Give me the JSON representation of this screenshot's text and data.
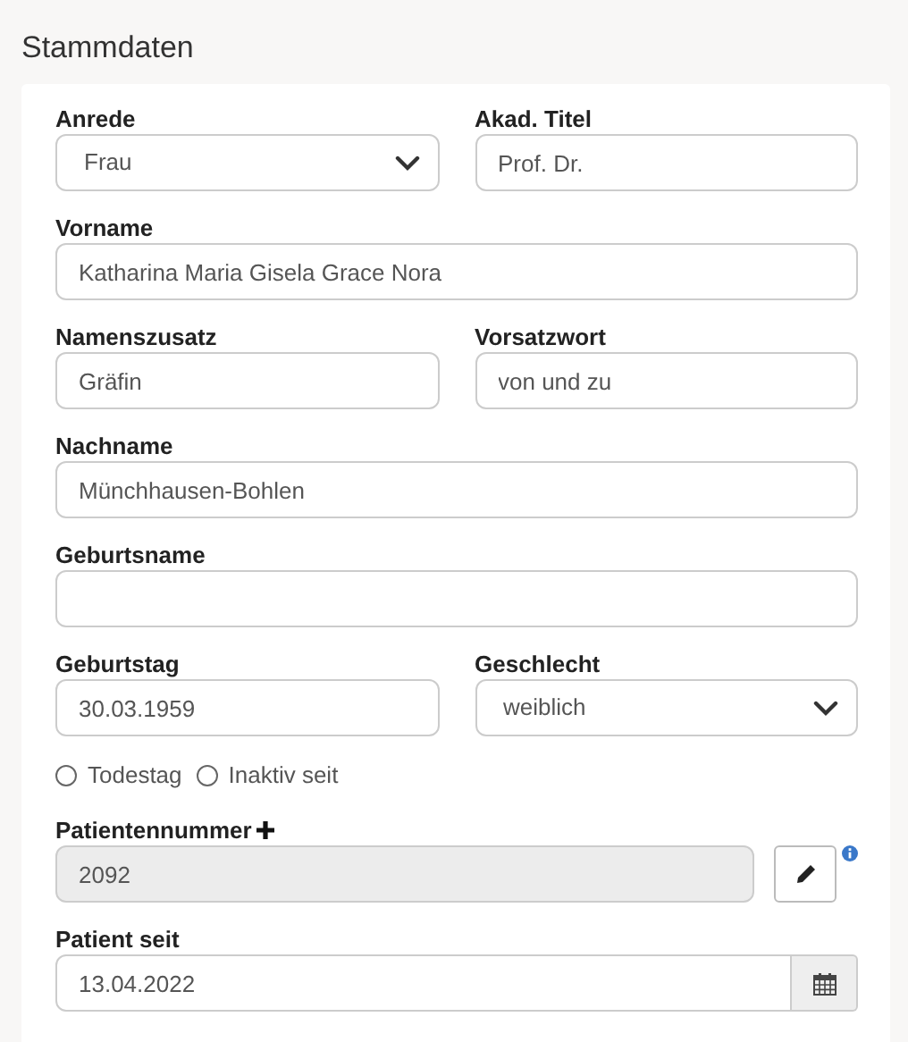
{
  "section_title": "Stammdaten",
  "rows": [
    {
      "kind": "fields",
      "fields": [
        {
          "kind": "select",
          "label": "Anrede",
          "value": "Frau"
        },
        {
          "kind": "text",
          "label": "Akad. Titel",
          "value": "Prof. Dr."
        }
      ]
    },
    {
      "kind": "fields",
      "fields": [
        {
          "kind": "text",
          "label": "Vorname",
          "value": "Katharina Maria Gisela Grace Nora"
        }
      ]
    },
    {
      "kind": "fields",
      "fields": [
        {
          "kind": "text",
          "label": "Namenszusatz",
          "value": "Gräfin"
        },
        {
          "kind": "text",
          "label": "Vorsatzwort",
          "value": "von und zu"
        }
      ]
    },
    {
      "kind": "fields",
      "fields": [
        {
          "kind": "text",
          "label": "Nachname",
          "value": "Münchhausen-Bohlen"
        }
      ]
    },
    {
      "kind": "fields",
      "fields": [
        {
          "kind": "text",
          "label": "Geburtsname"
        }
      ]
    },
    {
      "kind": "fields",
      "fields": [
        {
          "kind": "text",
          "label": "Geburtstag",
          "value": "30.03.1959"
        },
        {
          "kind": "select",
          "label": "Geschlecht",
          "value": "weiblich"
        }
      ]
    },
    {
      "kind": "radios",
      "options": [
        {
          "label": "Todestag",
          "selected": false
        },
        {
          "label": "Inaktiv seit",
          "selected": false
        }
      ]
    },
    {
      "kind": "fields",
      "fields": [
        {
          "kind": "readonly",
          "label": "Patientennummer",
          "value": "2092"
        }
      ]
    },
    {
      "kind": "fields",
      "fields": [
        {
          "kind": "date",
          "label": "Patient seit",
          "value": "13.04.2022"
        }
      ]
    }
  ]
}
